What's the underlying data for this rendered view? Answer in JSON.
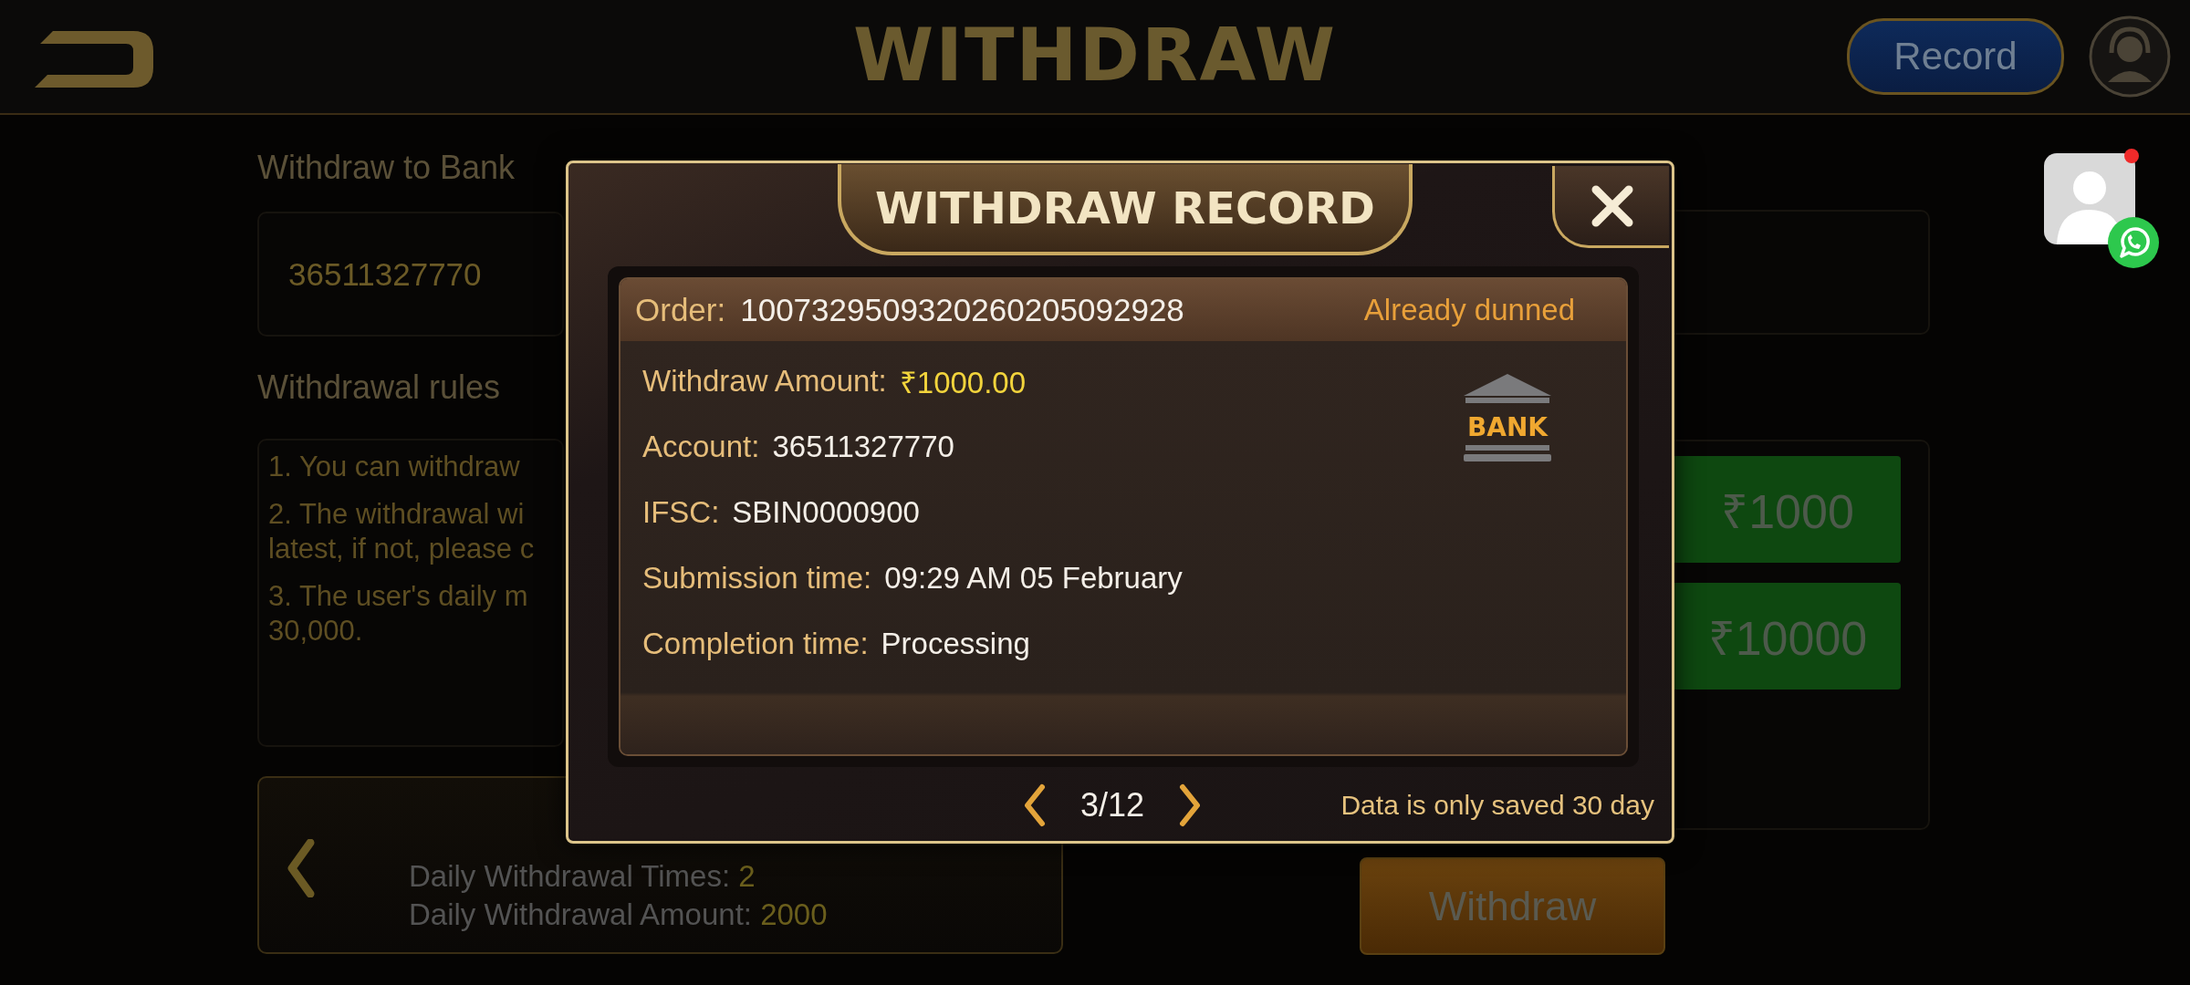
{
  "top_bar": {
    "title": "WITHDRAW",
    "record_button": "Record"
  },
  "form": {
    "bank_label": "Withdraw to Bank",
    "account": "36511327770",
    "rules_label": "Withdrawal rules",
    "rules": [
      {
        "lines": [
          "1. You can withdraw"
        ]
      },
      {
        "lines": [
          "2. The withdrawal wi",
          "latest, if not, please c"
        ]
      },
      {
        "lines": [
          "3. The user's daily m",
          "30,000."
        ]
      }
    ],
    "daily": [
      {
        "label": "Daily Withdrawal Times:",
        "value": "2"
      },
      {
        "label": "Daily Withdrawal Amount:",
        "value": "2000"
      }
    ],
    "amount_options": [
      "₹1000",
      "₹10000"
    ],
    "withdraw_button": "Withdraw"
  },
  "modal": {
    "title": "WITHDRAW RECORD",
    "order": {
      "label": "Order:",
      "value": "1007329509320260205092928"
    },
    "status": "Already dunned",
    "bank_icon": "BANK",
    "fields": [
      {
        "kind": "amount",
        "label": "Withdraw Amount:",
        "value": "₹1000.00"
      },
      {
        "kind": "text",
        "label": "Account:",
        "value": "36511327770"
      },
      {
        "kind": "text",
        "label": "IFSC:",
        "value": "SBIN0000900"
      },
      {
        "kind": "text",
        "label": "Submission time:",
        "value": "09:29 AM 05 February"
      },
      {
        "kind": "text",
        "label": "Completion time:",
        "value": "Processing"
      }
    ],
    "page": "3/12",
    "note": "Data is only saved 30 day"
  },
  "support_widget": {
    "unread": true
  }
}
